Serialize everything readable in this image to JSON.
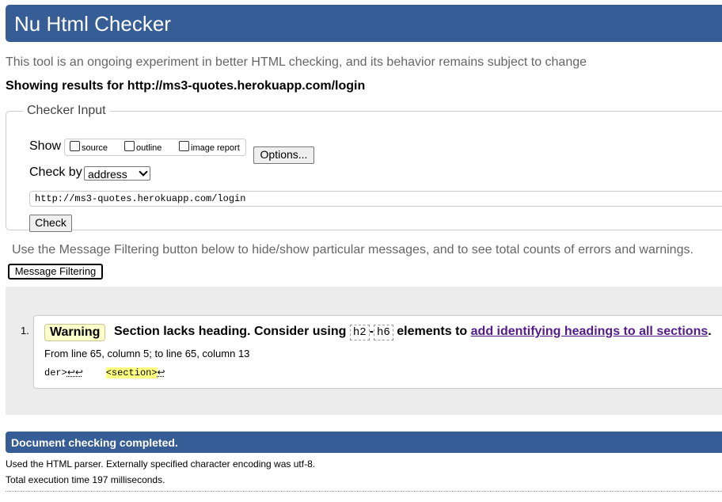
{
  "header": {
    "title": "Nu Html Checker"
  },
  "intro": "This tool is an ongoing experiment in better HTML checking, and its behavior remains subject to change",
  "results_for": "Showing results for http://ms3-quotes.herokuapp.com/login",
  "checker_input": {
    "legend": "Checker Input",
    "show_label": "Show",
    "options": [
      "source",
      "outline",
      "image report"
    ],
    "options_button": "Options...",
    "check_by_label": "Check by",
    "check_by_value": "address",
    "url_value": "http://ms3-quotes.herokuapp.com/login",
    "check_button": "Check"
  },
  "filter_note": "Use the Message Filtering button below to hide/show particular messages, and to see total counts of errors and warnings.",
  "filter_button": "Message Filtering",
  "messages": [
    {
      "number": "1.",
      "type": "Warning",
      "text_pre": "Section lacks heading. Consider using",
      "code1": "h2",
      "dash": "-",
      "code2": "h6",
      "text_mid": "elements to",
      "link": "add identifying headings to all sections",
      "text_end": ".",
      "location": "From line 65, column 5; to line 65, column 13",
      "extract_pre": "der>",
      "extract_lf1": "↩↩",
      "extract_gap": "    ",
      "extract_hl": "<section>",
      "extract_lf2": "↩"
    }
  ],
  "done": "Document checking completed.",
  "details": [
    "Used the HTML parser. Externally specified character encoding was utf-8.",
    "Total execution time 197 milliseconds."
  ],
  "colors": {
    "header_bg": "#365d95",
    "warning_bg": "#ffffcc",
    "link": "#551a8b"
  }
}
